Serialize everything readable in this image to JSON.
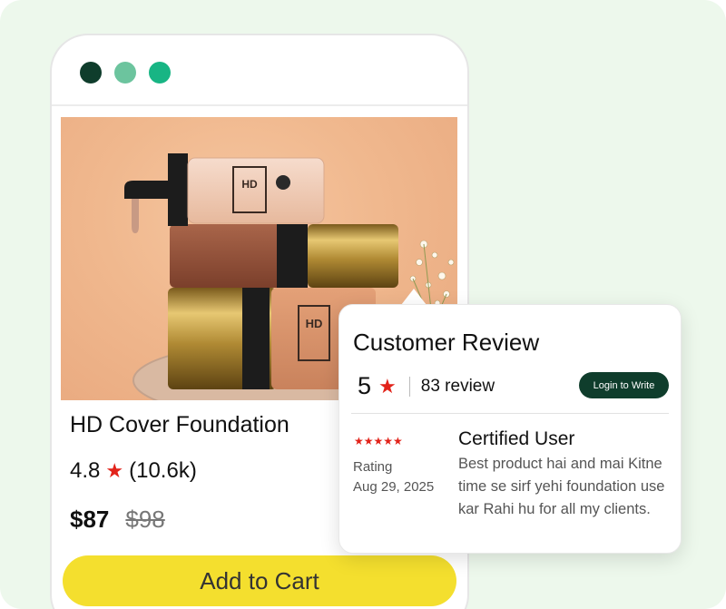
{
  "colors": {
    "background": "#edf8ec",
    "dot_1": "#0f3d2c",
    "dot_2": "#6cc49e",
    "dot_3": "#18b584",
    "accent_yellow": "#f4df2e",
    "star_red": "#e2231a",
    "login_button": "#0f3d2c"
  },
  "window": {
    "dots": [
      "dark-green",
      "light-green",
      "teal-green"
    ]
  },
  "product": {
    "title": "HD Cover Foundation",
    "rating": "4.8",
    "rating_icon": "star-icon",
    "rating_count": "(10.6k)",
    "price_current": "$87",
    "price_original": "$98",
    "add_to_cart_label": "Add to Cart",
    "image_subject": "foundation-bottles-image"
  },
  "review_card": {
    "title": "Customer Review",
    "score": "5",
    "score_icon": "star-icon",
    "review_count": "83 review",
    "login_label": "Login to Write",
    "review": {
      "stars": "★★★★★",
      "rating_label": "Rating",
      "date": "Aug 29, 2025",
      "reviewer": "Certified User",
      "text": "Best product hai and mai Kitne time se sirf yehi foundation use kar Rahi hu for all my clients."
    }
  }
}
